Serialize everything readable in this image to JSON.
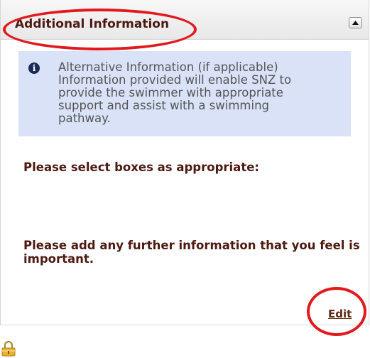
{
  "panel": {
    "title": "Additional Information",
    "collapse_icon": "triangle-up-icon"
  },
  "info": {
    "icon": "info-icon",
    "icon_glyph": "i",
    "line1": "Alternative Information (if applicable)",
    "line2": "Information provided will enable SNZ to",
    "line3": "provide the swimmer with appropriate",
    "line4": "support and assist with a swimming",
    "line5": "pathway."
  },
  "prompts": {
    "select_boxes": "Please select boxes as appropriate:",
    "further_info": "Please add any further information that you feel is important."
  },
  "actions": {
    "edit_label": "Edit"
  },
  "footer": {
    "lock_icon": "padlock-icon"
  },
  "colors": {
    "heading": "#4d1a12",
    "info_bg": "#d9e2f7",
    "annotation": "#e2191d"
  }
}
